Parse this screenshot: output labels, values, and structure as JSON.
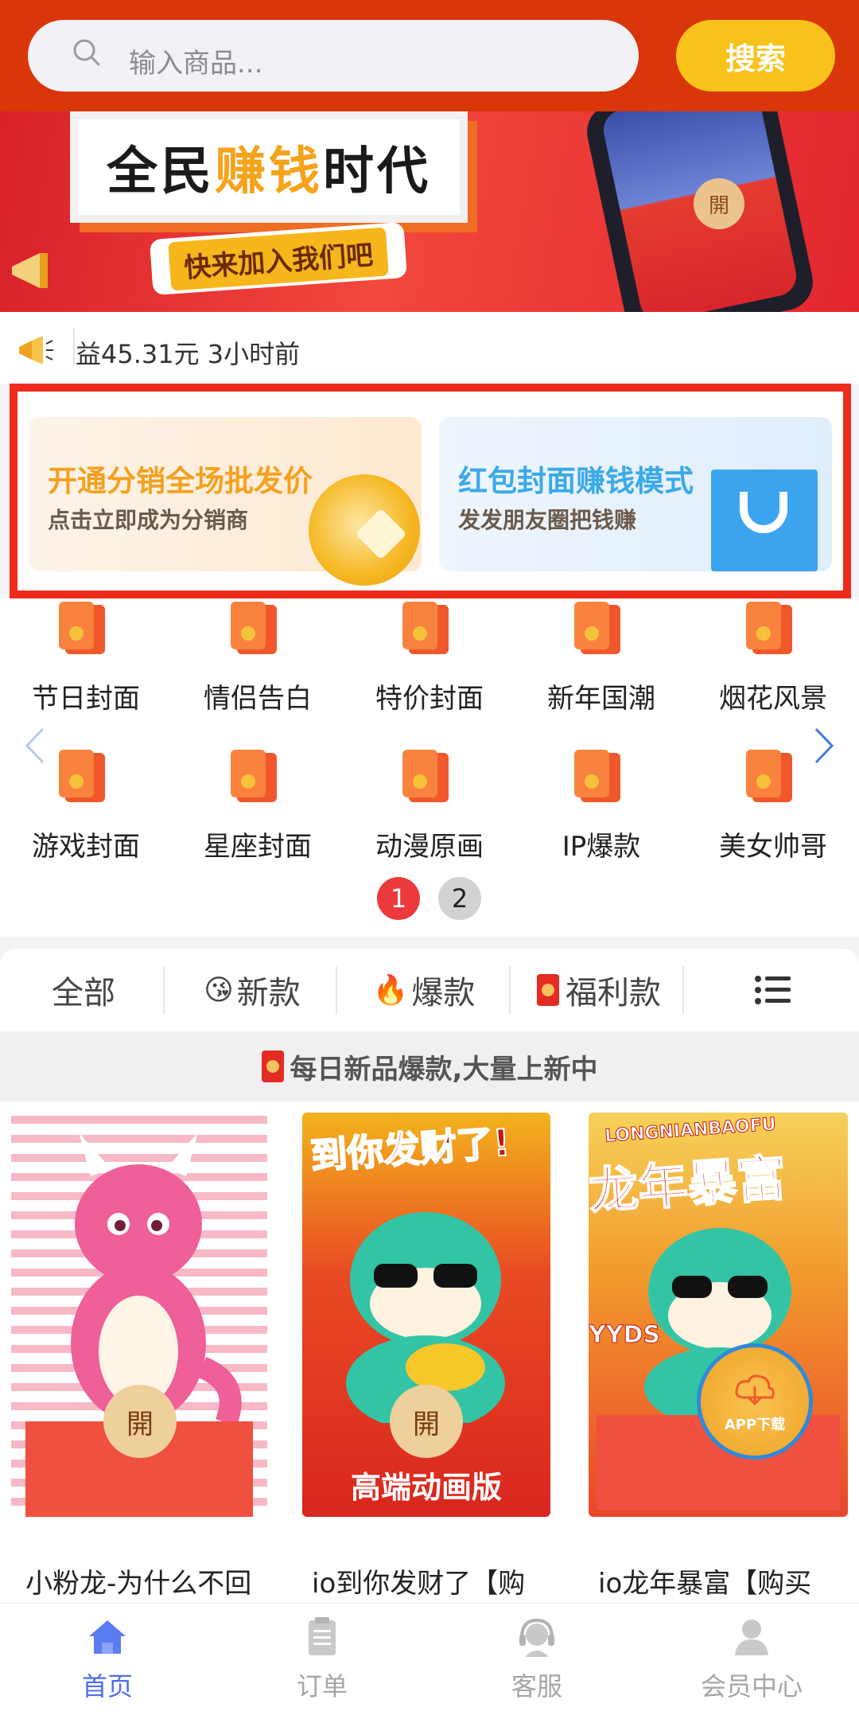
{
  "header": {
    "search_placeholder": "输入商品...",
    "search_button": "搜索"
  },
  "banner": {
    "title_part1": "全民",
    "title_highlight": "赚钱",
    "title_part2": "时代",
    "subtitle": "快来加入我们吧",
    "phone_open_badge": "開"
  },
  "notice": {
    "text": "益45.31元 3小时前"
  },
  "promos": [
    {
      "title": "开通分销全场批发价",
      "subtitle": "点击立即成为分销商",
      "title_color": "#f5a01e"
    },
    {
      "title": "红包封面赚钱模式",
      "subtitle": "发发朋友圈把钱赚",
      "title_color": "#3aa9ea"
    }
  ],
  "categories": [
    {
      "label": "节日封面"
    },
    {
      "label": "情侣告白"
    },
    {
      "label": "特价封面"
    },
    {
      "label": "新年国潮"
    },
    {
      "label": "烟花风景"
    },
    {
      "label": "游戏封面"
    },
    {
      "label": "星座封面"
    },
    {
      "label": "动漫原画"
    },
    {
      "label": "IP爆款"
    },
    {
      "label": "美女帅哥"
    }
  ],
  "pagination": {
    "page1": "1",
    "page2": "2",
    "current": 1
  },
  "filter_tabs": [
    {
      "label": "全部",
      "icon": "none"
    },
    {
      "label": "新款",
      "icon": "kiss-face-icon",
      "emoji": "😘"
    },
    {
      "label": "爆款",
      "icon": "fire-icon",
      "emoji": "🔥"
    },
    {
      "label": "福利款",
      "icon": "hongbao-icon"
    }
  ],
  "section_title": "每日新品爆款,大量上新中",
  "products": [
    {
      "name": "小粉龙-为什么不回",
      "open_badge": "開",
      "art_text": ""
    },
    {
      "name": "io到你发财了【购",
      "open_badge": "開",
      "art_top": "到你发财了!",
      "art_bottom": "高端动画版"
    },
    {
      "name": "io龙年暴富【购买",
      "open_badge": "開",
      "art_top": "LONGNIANBAOFU",
      "art_main": "龙年暴富",
      "art_side": "YYDS"
    }
  ],
  "download_fab": "APP下载",
  "bottom_nav": [
    {
      "label": "首页",
      "active": true
    },
    {
      "label": "订单",
      "active": false
    },
    {
      "label": "客服",
      "active": false
    },
    {
      "label": "会员中心",
      "active": false
    }
  ],
  "colors": {
    "header_bg": "#d9360a",
    "search_button_bg": "#f7c219",
    "promo_border": "#ef2b1c",
    "active_nav": "#4e6ef2",
    "page_dot_active": "#ec3a3c"
  }
}
